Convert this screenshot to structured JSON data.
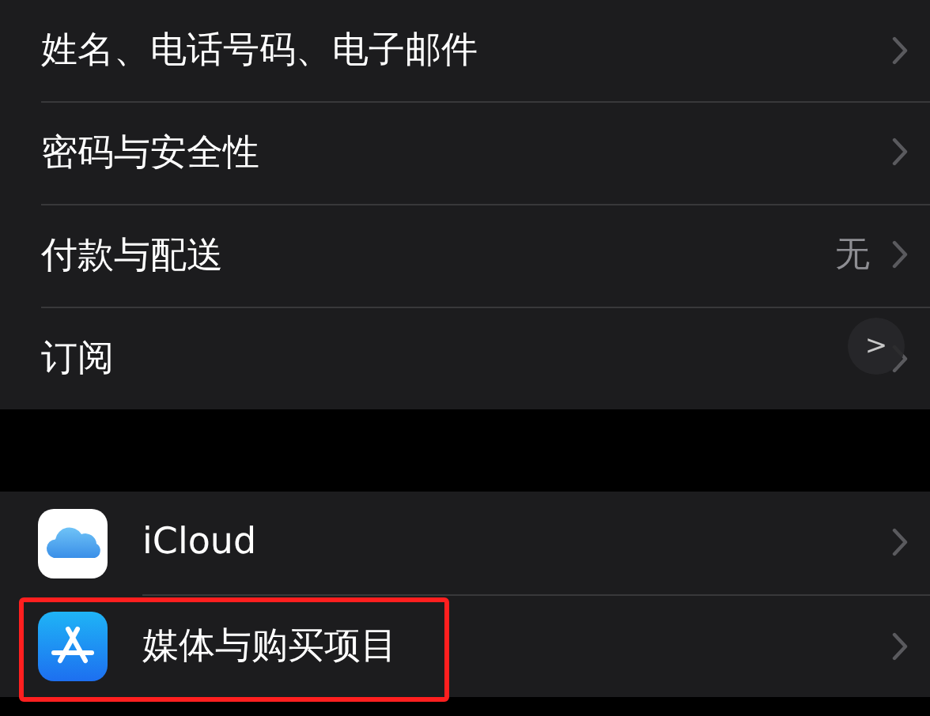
{
  "groups": [
    {
      "items": [
        {
          "label": "姓名、电话号码、电子邮件",
          "highlighted": false
        },
        {
          "label": "密码与安全性",
          "highlighted": false
        },
        {
          "label": "付款与配送",
          "value": "无",
          "highlighted": false
        },
        {
          "label": "订阅",
          "highlighted": false
        }
      ]
    },
    {
      "items": [
        {
          "label": "iCloud",
          "kind": "cloud",
          "highlighted": false
        },
        {
          "label": "媒体与购买项目",
          "kind": "store",
          "highlighted": true
        }
      ]
    }
  ],
  "floating_button": {
    "label": ">"
  }
}
